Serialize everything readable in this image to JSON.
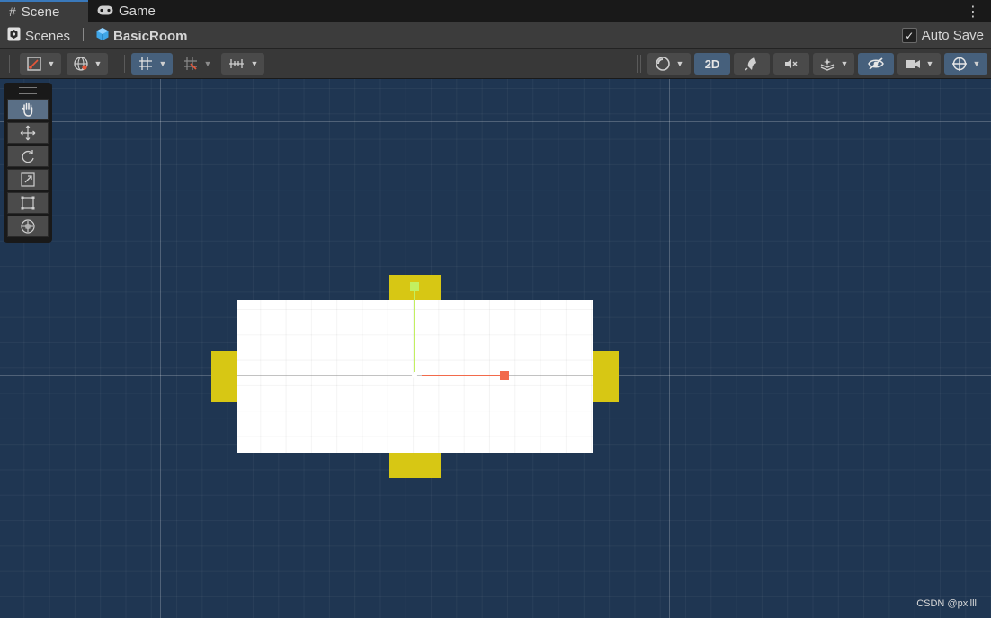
{
  "tabs": [
    {
      "label": "Scene",
      "icon": "grid-icon"
    },
    {
      "label": "Game",
      "icon": "gamepad-icon"
    }
  ],
  "breadcrumb": {
    "root": "Scenes",
    "scene": "BasicRoom"
  },
  "autosave": {
    "label": "Auto Save",
    "checked": true
  },
  "toolbar": {
    "mode_2d": "2D"
  },
  "colors": {
    "viewport": "#1f3652",
    "room": "#ffffff",
    "door": "#d7c714",
    "x_axis": "#f26a4b",
    "y_axis": "#c2f060"
  },
  "watermark": "CSDN @pxllll"
}
